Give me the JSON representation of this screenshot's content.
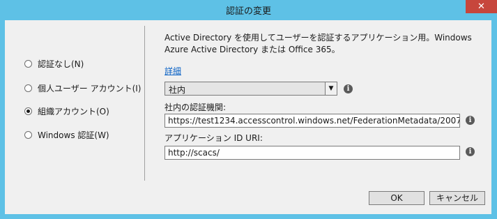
{
  "window": {
    "title": "認証の変更",
    "close_glyph": "✕"
  },
  "auth_options": [
    {
      "label": "認証なし(N)",
      "selected": false
    },
    {
      "label": "個人ユーザー アカウント(I)",
      "selected": false
    },
    {
      "label": "組織アカウント(O)",
      "selected": true
    },
    {
      "label": "Windows 認証(W)",
      "selected": false
    }
  ],
  "description": "Active Directory を使用してユーザーを認証するアプリケーション用。Windows Azure Active Directory または Office 365。",
  "details_link": "詳細",
  "org_type": {
    "value": "社内",
    "arrow_glyph": "▼"
  },
  "authority": {
    "label": "社内の認証機関:",
    "value": "https://test1234.accesscontrol.windows.net/FederationMetadata/2007-"
  },
  "app_id_uri": {
    "label": "アプリケーション ID URI:",
    "value": "http://scacs/"
  },
  "info_glyph": "i",
  "buttons": {
    "ok": "OK",
    "cancel": "キャンセル"
  },
  "colors": {
    "title_bar": "#5ec1e6",
    "close_button": "#c7463c",
    "link": "#0a62c5"
  }
}
